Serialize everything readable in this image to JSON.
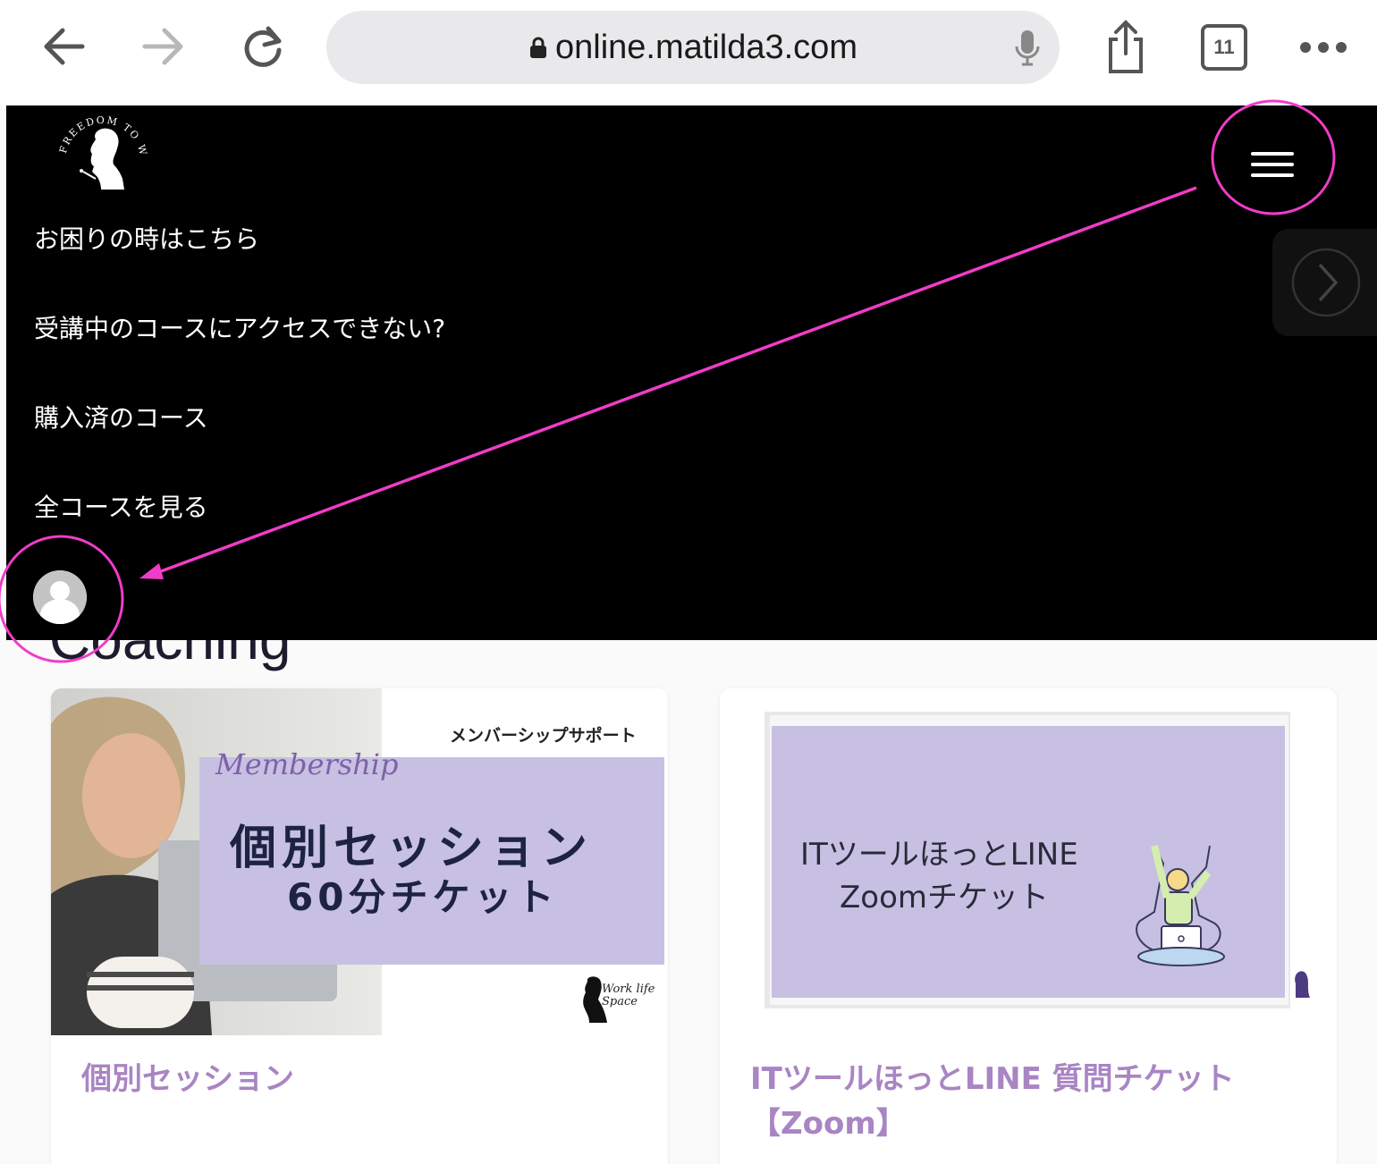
{
  "browser": {
    "url": "online.matilda3.com",
    "tab_count": "11"
  },
  "site": {
    "logo_text": "FREEDOM TO WORK",
    "menu": [
      {
        "label": "お困りの時はこちら"
      },
      {
        "label": "受講中のコースにアクセスできない?"
      },
      {
        "label": "購入済のコース"
      },
      {
        "label": "全コースを見る"
      }
    ]
  },
  "section": {
    "title": "Coaching"
  },
  "cards": [
    {
      "image_top": "メンバーシップサポート",
      "image_script": "Membership",
      "image_main_1": "個別セッション",
      "image_main_2": "60分チケット",
      "image_brand": "Work life Space",
      "title": "個別セッション"
    },
    {
      "image_line_1": "ITツールほっとLINE",
      "image_line_2": "Zoomチケット",
      "title_line_1": "ITツールほっとLINE 質問チケット",
      "title_line_2": "【Zoom】"
    }
  ],
  "colors": {
    "header_bg": "#000000",
    "annotation": "#f03cc8",
    "card_title": "#a985c4",
    "banner_purple": "#c7c0e2"
  }
}
